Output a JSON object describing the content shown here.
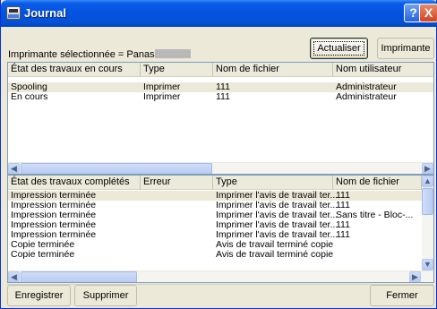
{
  "window": {
    "title": "Journal",
    "help_glyph": "?",
    "close_glyph": "X"
  },
  "printer": {
    "label": "Imprimante sélectionnée = Panasonic"
  },
  "toolbar": {
    "refresh_label": "Actualiser",
    "printer_label": "Imprimante"
  },
  "current_jobs": {
    "columns": [
      "État des travaux en cours",
      "Type",
      "Nom de fichier",
      "Nom utilisateur"
    ],
    "rows": [
      [
        "Spooling",
        "Imprimer",
        "111",
        "Administrateur"
      ],
      [
        "En cours",
        "Imprimer",
        "111",
        "Administrateur"
      ]
    ]
  },
  "completed_jobs": {
    "columns": [
      "État des travaux complétés",
      "Erreur",
      "Type",
      "Nom de fichier"
    ],
    "rows": [
      [
        "Impression terminée",
        "",
        "Imprimer l'avis de travail ter...",
        "111"
      ],
      [
        "Impression terminée",
        "",
        "Imprimer l'avis de travail ter...",
        "111"
      ],
      [
        "Impression terminée",
        "",
        "Imprimer l'avis de travail ter...",
        "Sans titre - Bloc-..."
      ],
      [
        "Impression terminée",
        "",
        "Imprimer l'avis de travail ter...",
        "111"
      ],
      [
        "Impression terminée",
        "",
        "Imprimer l'avis de travail ter...",
        "111"
      ],
      [
        "Copie terminée",
        "",
        "Avis de travail terminé copie",
        ""
      ],
      [
        "Copie terminée",
        "",
        "Avis de travail terminé copie",
        ""
      ]
    ]
  },
  "footer": {
    "save_label": "Enregistrer",
    "delete_label": "Supprimer",
    "close_label": "Fermer"
  },
  "icons": {
    "app": "journal-icon",
    "help": "help-icon",
    "close": "close-icon",
    "scroll_left": "◀",
    "scroll_right": "▶",
    "scroll_up": "▲",
    "scroll_down": "▼"
  }
}
